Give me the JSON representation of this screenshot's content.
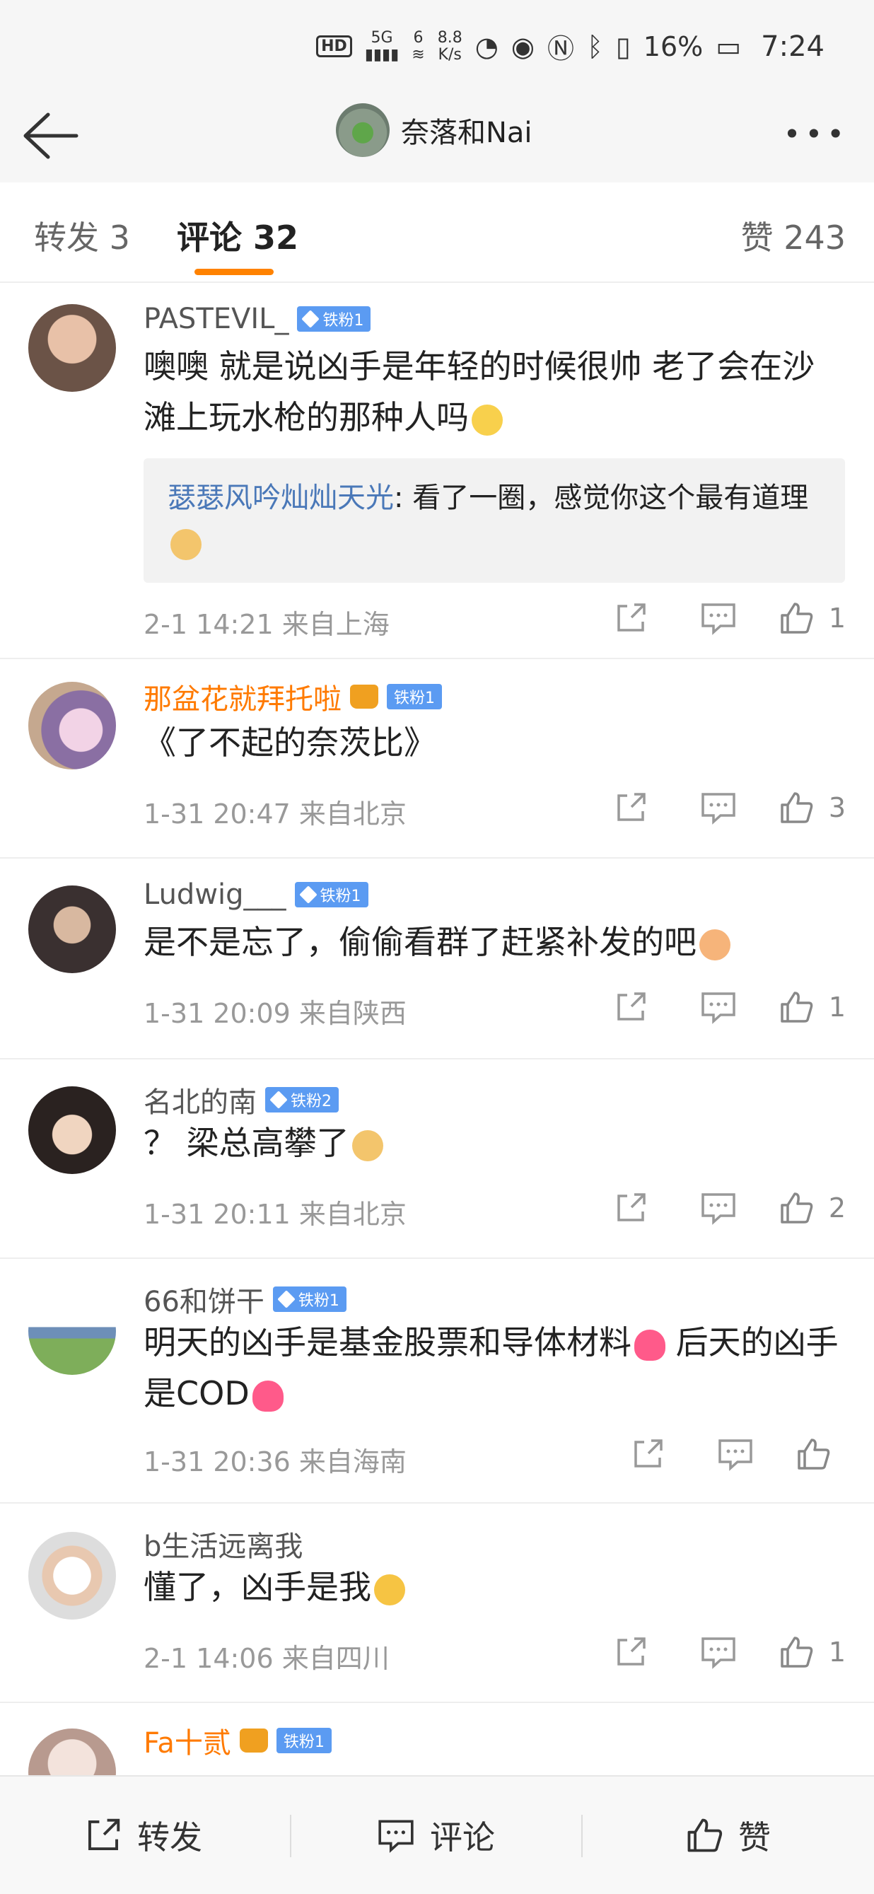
{
  "status_bar": {
    "hd": "HD",
    "net": "5G",
    "wifi_index": "6",
    "speed_value": "8.8",
    "speed_unit": "K/s",
    "battery": "16%",
    "time": "7:24"
  },
  "header": {
    "title": "奈落和Nai"
  },
  "tabs": [
    {
      "label": "转发 3"
    },
    {
      "label": "评论 32"
    },
    {
      "label": "赞 243"
    }
  ],
  "comments": [
    {
      "username": "PASTEVIL_",
      "badge": "铁粉1",
      "text": "噢噢 就是说凶手是年轻的时候很帅 老了会在沙滩上玩水枪的那种人吗",
      "reply_name": "瑟瑟风吟灿灿天光",
      "reply_text": ": 看了一圈，感觉你这个最有道理",
      "meta": "2-1 14:21  来自上海",
      "likes": "1"
    },
    {
      "username": "那盆花就拜托啦",
      "badge": "铁粉1",
      "text": "《了不起的奈茨比》",
      "meta": "1-31 20:47  来自北京",
      "likes": "3"
    },
    {
      "username": "Ludwig___",
      "badge": "铁粉1",
      "text": "是不是忘了，偷偷看群了赶紧补发的吧",
      "meta": "1-31 20:09  来自陕西",
      "likes": "1"
    },
    {
      "username": "名北的南",
      "badge": "铁粉2",
      "text": "？ 梁总高攀了",
      "meta": "1-31 20:11  来自北京",
      "likes": "2"
    },
    {
      "username": "66和饼干",
      "badge": "铁粉1",
      "text": "明天的凶手是基金股票和导体材料",
      "text2": " 后天的凶手是COD",
      "meta": "1-31 20:36  来自海南",
      "likes": ""
    },
    {
      "username": "b生活远离我",
      "text": "懂了，凶手是我",
      "meta": "2-1 14:06  来自四川",
      "likes": "1"
    },
    {
      "username": "Fa十贰",
      "badge": "铁粉1"
    }
  ],
  "bottom_bar": {
    "repost": "转发",
    "comment": "评论",
    "like": "赞"
  },
  "colors": {
    "accent": "#ff8200",
    "link": "#4a78b8",
    "badge": "#5b9bf2",
    "vip_name": "#ff7a00"
  }
}
